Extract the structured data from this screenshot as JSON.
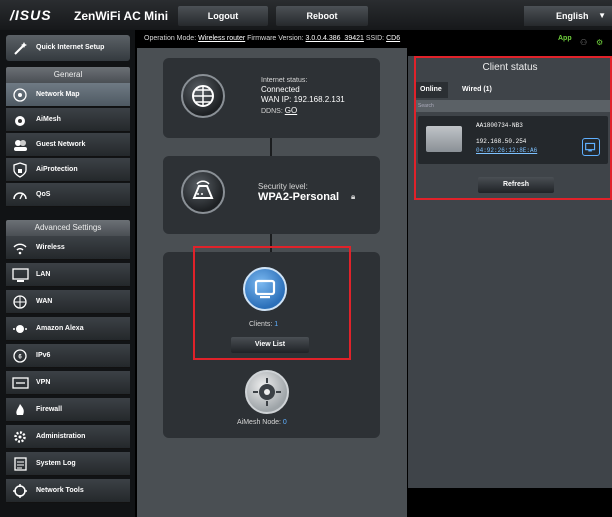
{
  "header": {
    "logo": "/ISUS",
    "model": "ZenWiFi AC Mini",
    "logout_label": "Logout",
    "reboot_label": "Reboot",
    "language": "English"
  },
  "infobar": {
    "op_mode_label": "Operation Mode:",
    "op_mode_value": "Wireless router",
    "fw_label": "Firmware Version:",
    "fw_value": "3.0.0.4.386_39421",
    "ssid_label": "SSID:",
    "ssid_value": "CD6",
    "app_label": "App"
  },
  "sidebar": {
    "quick_setup": "Quick Internet Setup",
    "general_header": "General",
    "general_items": [
      {
        "label": "Network Map",
        "icon": "network-map-icon"
      },
      {
        "label": "AiMesh",
        "icon": "aimesh-icon"
      },
      {
        "label": "Guest Network",
        "icon": "guest-network-icon"
      },
      {
        "label": "AiProtection",
        "icon": "shield-lock-icon"
      },
      {
        "label": "QoS",
        "icon": "speedometer-icon"
      }
    ],
    "advanced_header": "Advanced Settings",
    "advanced_items": [
      {
        "label": "Wireless",
        "icon": "wifi-icon"
      },
      {
        "label": "LAN",
        "icon": "lan-icon"
      },
      {
        "label": "WAN",
        "icon": "globe-icon"
      },
      {
        "label": "Amazon Alexa",
        "icon": "alexa-icon"
      },
      {
        "label": "IPv6",
        "icon": "ipv6-icon"
      },
      {
        "label": "VPN",
        "icon": "vpn-icon"
      },
      {
        "label": "Firewall",
        "icon": "firewall-icon"
      },
      {
        "label": "Administration",
        "icon": "admin-gear-icon"
      },
      {
        "label": "System Log",
        "icon": "system-log-icon"
      },
      {
        "label": "Network Tools",
        "icon": "network-tools-icon"
      }
    ]
  },
  "internet": {
    "status_label": "Internet status:",
    "status_value": "Connected",
    "wan_ip": "WAN IP: 192.168.2.131",
    "ddns_label": "DDNS:",
    "ddns_link": "GO"
  },
  "security": {
    "label": "Security level:",
    "value": "WPA2-Personal"
  },
  "clients": {
    "label": "Clients:",
    "count": "1",
    "view_list": "View List"
  },
  "aimesh": {
    "label": "AiMesh Node:",
    "count": "0"
  },
  "client_status": {
    "title": "Client status",
    "tab_online": "Online",
    "tab_wired": "Wired (1)",
    "search_placeholder": "Search",
    "client_name": "AA1800734-NB3",
    "client_ip": "192.168.50.254",
    "client_mac": "04:92:26:12:8E:A6",
    "refresh": "Refresh"
  },
  "colors": {
    "highlight": "#e0222a",
    "accent_blue": "#2b6fb9",
    "app_green": "#6fcf3c"
  }
}
